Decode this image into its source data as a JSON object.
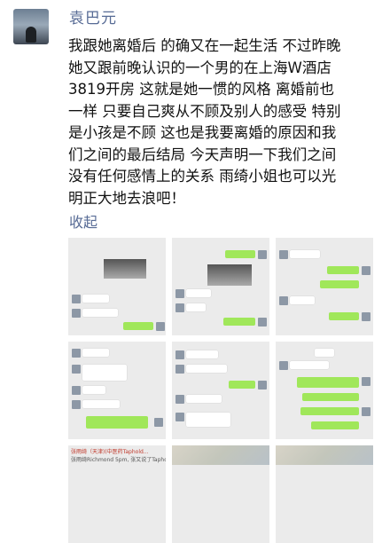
{
  "post": {
    "username": "袁巴元",
    "lines": [
      "我跟她离婚后 的确又在一起生活 不过昨晚",
      "她又跟前晚认识的一个男的在上海W酒店",
      "3819开房 这就是她一惯的风格 离婚前也",
      "一样 只要自己爽从不顾及别人的感受 特别",
      "是小孩是不顾 这也是我要离婚的原因和我",
      "们之间的最后结局 今天声明一下我们之间",
      "没有任何感情上的关系 雨绮小姐也可以光",
      "明正大地去浪吧！"
    ],
    "collapse_label": "收起"
  },
  "thumbnails": {
    "count": 9,
    "partial_text": {
      "line1": "张雨绮（天津)(中医药Taphold...",
      "line2": "张雨绮Richmond 5pm, 张又说了Taphold..."
    }
  }
}
